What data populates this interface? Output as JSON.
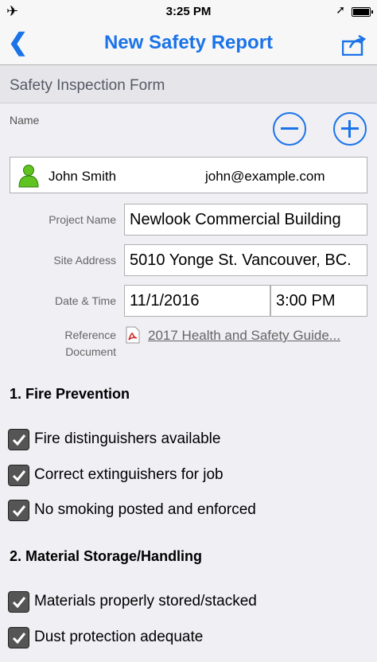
{
  "status_bar": {
    "time": "3:25 PM"
  },
  "nav": {
    "title": "New Safety Report"
  },
  "form": {
    "header": "Safety Inspection Form"
  },
  "name_section": {
    "label": "Name",
    "contact_name": "John Smith",
    "contact_email": "john@example.com"
  },
  "fields": {
    "project_name_label": "Project Name",
    "project_name_value": "Newlook Commercial Building",
    "site_address_label": "Site Address",
    "site_address_value": "5010 Yonge St. Vancouver, BC.",
    "datetime_label": "Date & Time",
    "date_value": "11/1/2016",
    "time_value": "3:00 PM",
    "reference_label_line1": "Reference",
    "reference_label_line2": "Document",
    "reference_link": "2017 Health and Safety Guide..."
  },
  "sections": [
    {
      "title": "1. Fire Prevention",
      "items": [
        "Fire distinguishers available",
        "Correct extinguishers for job",
        "No smoking posted and enforced"
      ]
    },
    {
      "title": "2. Material Storage/Handling",
      "items": [
        "Materials properly stored/stacked",
        "Dust protection adequate"
      ]
    }
  ],
  "colors": {
    "accent": "#1a73e8",
    "checkbox": "#555555"
  }
}
